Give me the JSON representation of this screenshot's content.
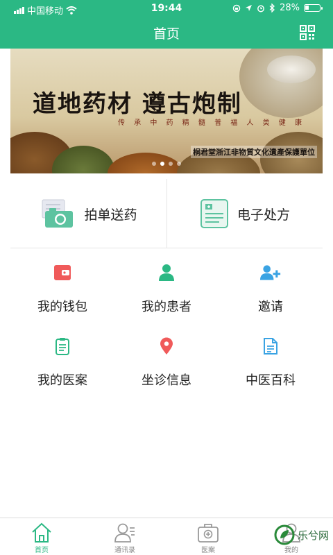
{
  "status_bar": {
    "carrier": "中国移动",
    "time": "19:44",
    "battery": "28%",
    "battery_level": 0.28
  },
  "header": {
    "title": "首页",
    "qr_icon": "qr-code-icon"
  },
  "banner": {
    "title": "道地药材 遵古炮制",
    "subtitle": "传 承 中 药 精 髓   普 福 人 类 健 康",
    "caption": "桐君堂浙江非物質文化遺產保護單位",
    "slide_count": 4,
    "active_slide": 1
  },
  "actions": [
    {
      "label": "拍单送药",
      "icon": "camera-prescription-icon"
    },
    {
      "label": "电子处方",
      "icon": "e-prescription-icon"
    }
  ],
  "grid": [
    {
      "label": "我的钱包",
      "icon": "wallet-icon",
      "color": "#f05a5a"
    },
    {
      "label": "我的患者",
      "icon": "patient-icon",
      "color": "#2bb884"
    },
    {
      "label": "邀请",
      "icon": "add-user-icon",
      "color": "#3aa3e3"
    },
    {
      "label": "我的医案",
      "icon": "clipboard-icon",
      "color": "#2bb884"
    },
    {
      "label": "坐诊信息",
      "icon": "location-pin-icon",
      "color": "#f05a5a"
    },
    {
      "label": "中医百科",
      "icon": "document-icon",
      "color": "#3aa3e3"
    }
  ],
  "tabbar": [
    {
      "label": "首页",
      "icon": "home-icon",
      "active": true
    },
    {
      "label": "通讯录",
      "icon": "contacts-icon",
      "active": false
    },
    {
      "label": "医案",
      "icon": "medical-kit-icon",
      "active": false
    },
    {
      "label": "我的",
      "icon": "profile-icon",
      "active": false
    }
  ],
  "watermark": {
    "text": "乐兮网"
  },
  "colors": {
    "brand": "#2bb884",
    "red": "#f05a5a",
    "blue": "#3aa3e3",
    "inactive": "#888888"
  }
}
